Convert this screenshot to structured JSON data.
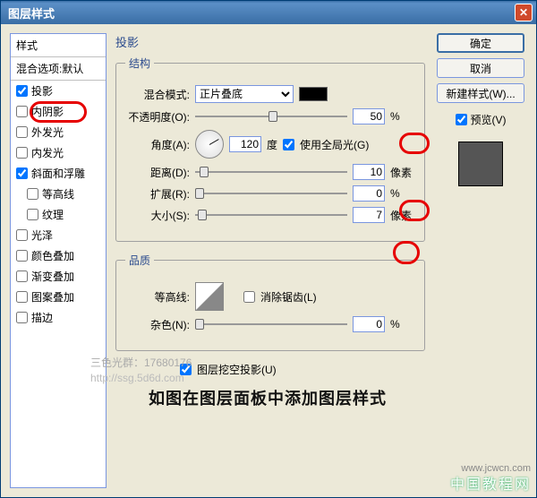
{
  "titlebar": {
    "title": "图层样式"
  },
  "styles": {
    "header": "样式",
    "blend_options": "混合选项:默认",
    "items": [
      {
        "label": "投影",
        "checked": true,
        "sub": false
      },
      {
        "label": "内阴影",
        "checked": false,
        "sub": false
      },
      {
        "label": "外发光",
        "checked": false,
        "sub": false
      },
      {
        "label": "内发光",
        "checked": false,
        "sub": false
      },
      {
        "label": "斜面和浮雕",
        "checked": true,
        "sub": false
      },
      {
        "label": "等高线",
        "checked": false,
        "sub": true
      },
      {
        "label": "纹理",
        "checked": false,
        "sub": true
      },
      {
        "label": "光泽",
        "checked": false,
        "sub": false
      },
      {
        "label": "颜色叠加",
        "checked": false,
        "sub": false
      },
      {
        "label": "渐变叠加",
        "checked": false,
        "sub": false
      },
      {
        "label": "图案叠加",
        "checked": false,
        "sub": false
      },
      {
        "label": "描边",
        "checked": false,
        "sub": false
      }
    ]
  },
  "main": {
    "title": "投影",
    "structure": {
      "legend": "结构",
      "blend_mode_label": "混合模式:",
      "blend_mode_value": "正片叠底",
      "opacity_label": "不透明度(O):",
      "opacity_value": "50",
      "percent": "%",
      "angle_label": "角度(A):",
      "angle_value": "120",
      "degree": "度",
      "global_light_label": "使用全局光(G)",
      "global_light_checked": true,
      "distance_label": "距离(D):",
      "distance_value": "10",
      "px": "像素",
      "spread_label": "扩展(R):",
      "spread_value": "0",
      "size_label": "大小(S):",
      "size_value": "7"
    },
    "quality": {
      "legend": "品质",
      "contour_label": "等高线:",
      "antialias_label": "消除锯齿(L)",
      "antialias_checked": false,
      "noise_label": "杂色(N):",
      "noise_value": "0"
    },
    "knockout_label": "图层挖空投影(U)",
    "knockout_checked": true
  },
  "buttons": {
    "ok": "确定",
    "cancel": "取消",
    "new_style": "新建样式(W)...",
    "preview": "预览(V)"
  },
  "caption": "如图在图层面板中添加图层样式",
  "wm1": "三色光群：17680176",
  "wm2": "http://ssg.5d6d.com",
  "footer": "中国教程网",
  "footer_url": "www.jcwcn.com"
}
